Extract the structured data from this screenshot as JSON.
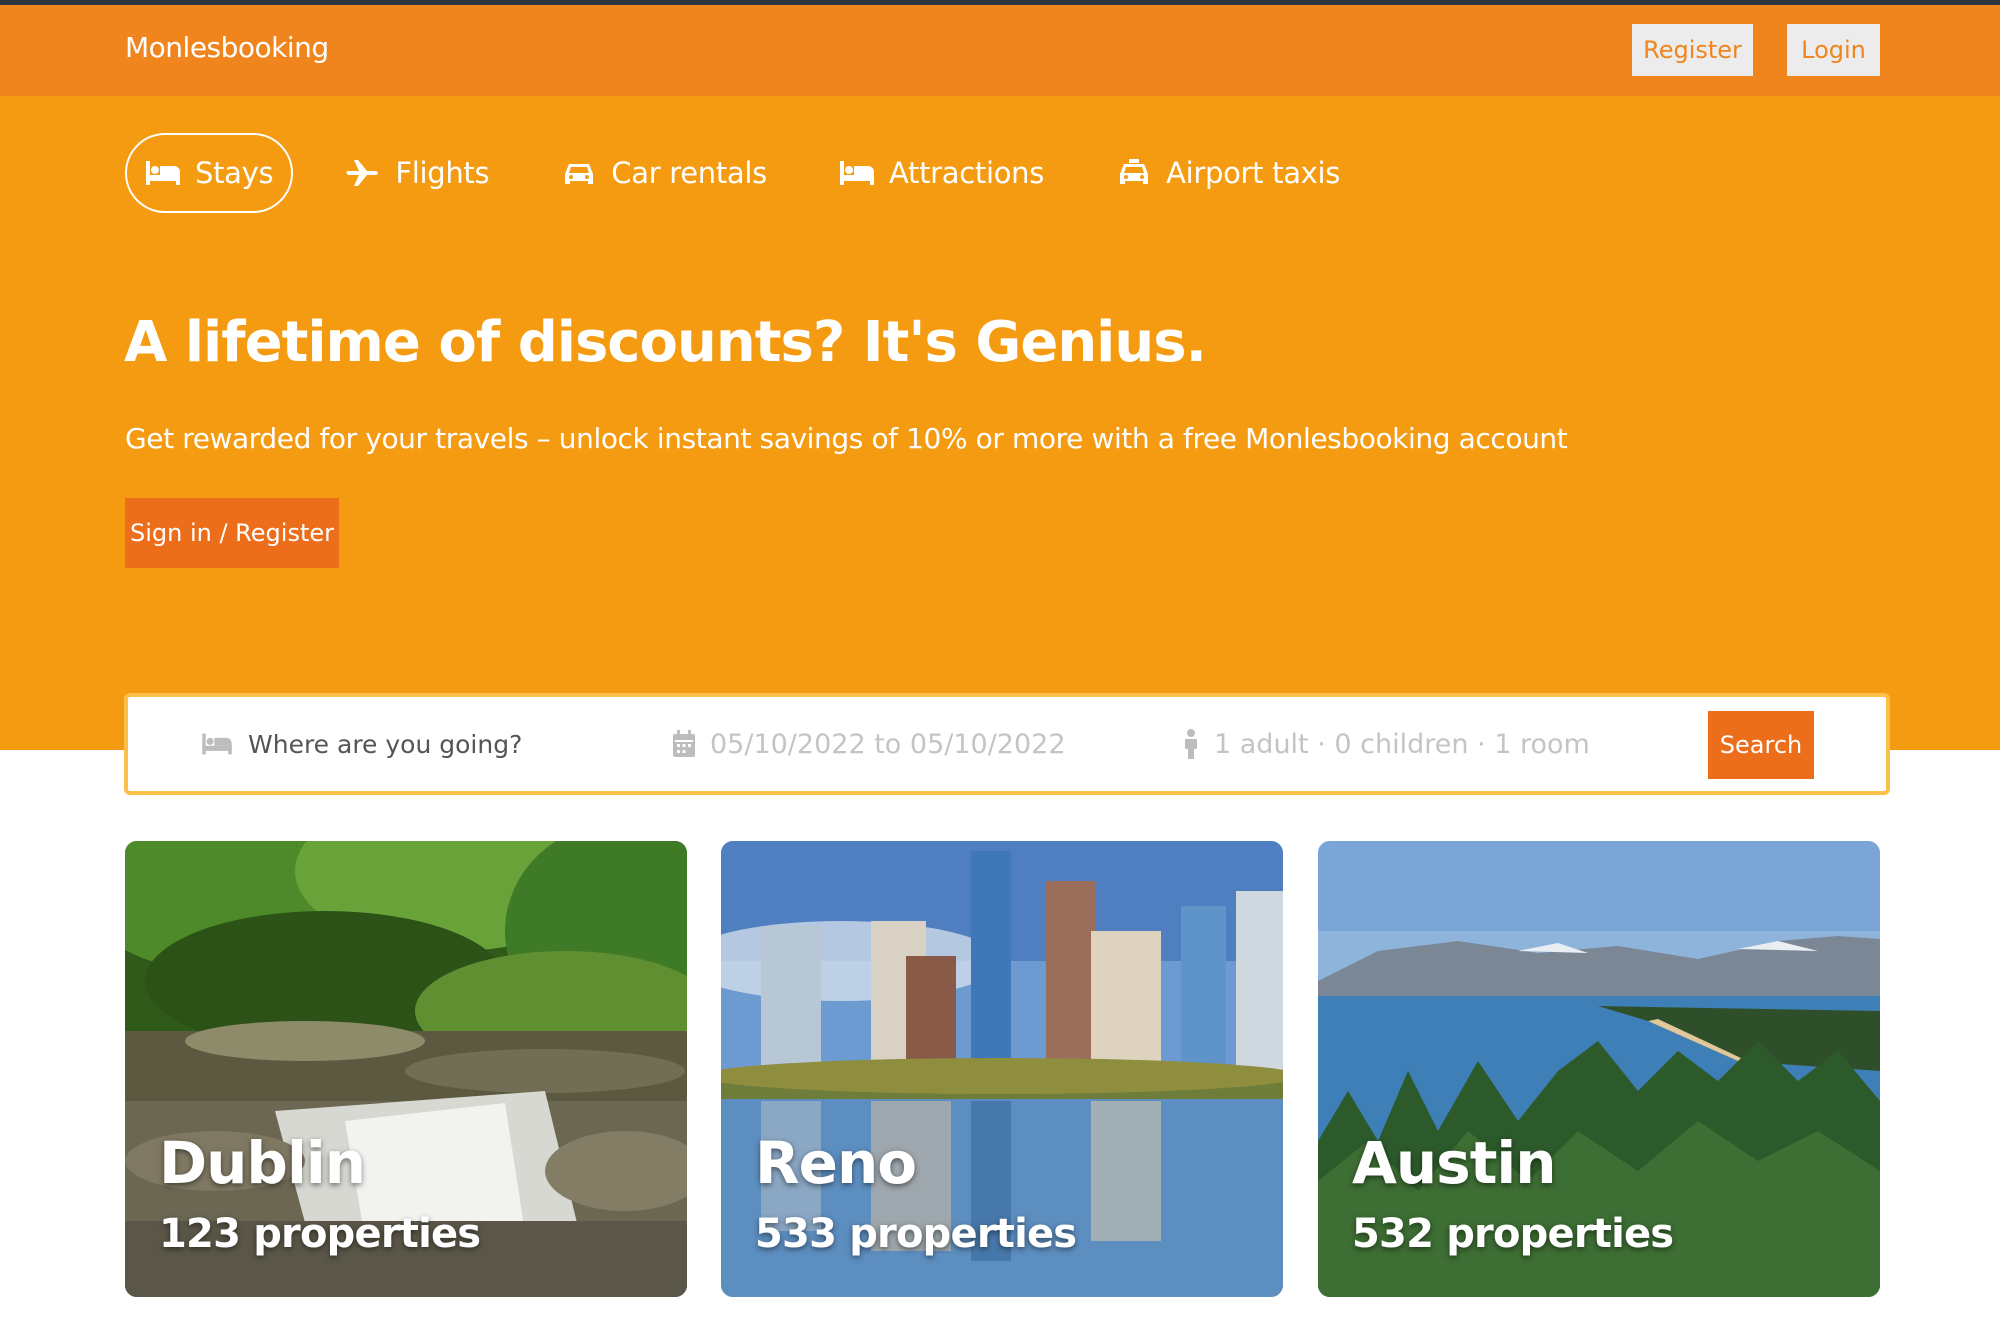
{
  "brand": "Monlesbooking",
  "nav": {
    "register_label": "Register",
    "login_label": "Login"
  },
  "tabs": [
    {
      "label": "Stays",
      "icon": "bed-icon",
      "active": true
    },
    {
      "label": "Flights",
      "icon": "plane-icon",
      "active": false
    },
    {
      "label": "Car rentals",
      "icon": "car-icon",
      "active": false
    },
    {
      "label": "Attractions",
      "icon": "bed-icon",
      "active": false
    },
    {
      "label": "Airport taxis",
      "icon": "taxi-icon",
      "active": false
    }
  ],
  "hero": {
    "headline": "A lifetime of discounts? It's Genius.",
    "subline": "Get rewarded for your travels – unlock instant savings of 10% or more with a free Monlesbooking account",
    "cta_label": "Sign in / Register"
  },
  "search": {
    "destination_placeholder": "Where are you going?",
    "dates": "05/10/2022 to 05/10/2022",
    "guests": "1 adult · 0 children · 1 room",
    "button_label": "Search"
  },
  "destinations": [
    {
      "city": "Dublin",
      "properties": "123 properties"
    },
    {
      "city": "Reno",
      "properties": "533 properties"
    },
    {
      "city": "Austin",
      "properties": "532 properties"
    }
  ],
  "colors": {
    "navbar": "#f0851d",
    "hero": "#f59b12",
    "button": "#ed6e1a",
    "search_border": "#fbc04a"
  }
}
